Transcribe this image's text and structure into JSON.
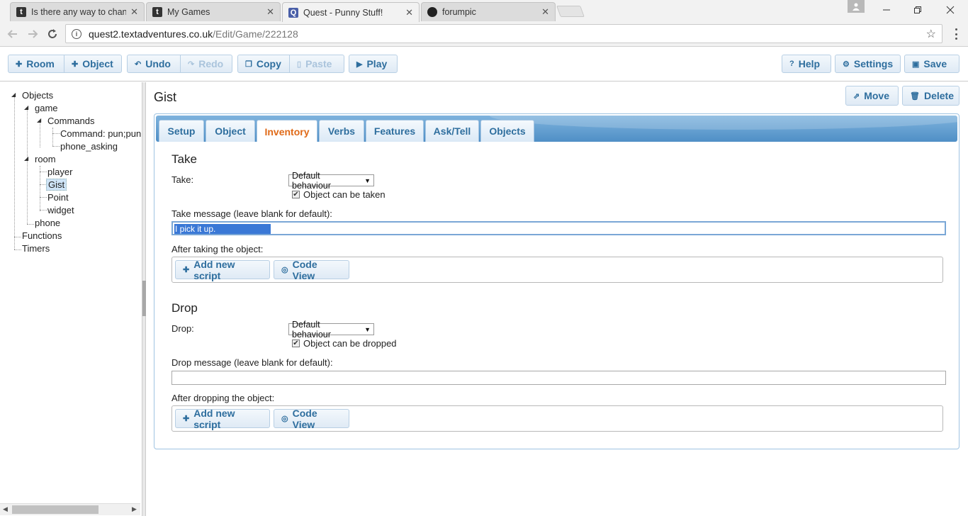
{
  "browser": {
    "tabs": [
      {
        "title": "Is there any way to chang",
        "icon": "t"
      },
      {
        "title": "My Games",
        "icon": "t"
      },
      {
        "title": "Quest - Punny Stuff!",
        "icon": "q"
      },
      {
        "title": "forumpic",
        "icon": "gh"
      }
    ],
    "close_glyph": "✕",
    "url_host": "quest2.textadventures.co.uk",
    "url_path": "/Edit/Game/222128"
  },
  "toolbar": {
    "room": "Room",
    "object": "Object",
    "undo": "Undo",
    "redo": "Redo",
    "copy": "Copy",
    "paste": "Paste",
    "play": "Play",
    "help": "Help",
    "settings": "Settings",
    "save": "Save"
  },
  "tree": {
    "objects": "Objects",
    "game": "game",
    "commands": "Commands",
    "command_pun": "Command: pun;pun",
    "phone_asking": "phone_asking",
    "room": "room",
    "player": "player",
    "gist": "Gist",
    "point": "Point",
    "widget": "widget",
    "phone": "phone",
    "functions": "Functions",
    "timers": "Timers"
  },
  "editor": {
    "title": "Gist",
    "move": "Move",
    "delete": "Delete",
    "tabs": [
      "Setup",
      "Object",
      "Inventory",
      "Verbs",
      "Features",
      "Ask/Tell",
      "Objects"
    ],
    "active_tab": "Inventory",
    "take": {
      "heading": "Take",
      "label": "Take:",
      "select_value": "Default behaviour",
      "checkbox_label": "Object can be taken",
      "checkbox_checked": true,
      "message_label": "Take message (leave blank for default):",
      "message_value": "I pick it up.",
      "after_label": "After taking the object:"
    },
    "drop": {
      "heading": "Drop",
      "label": "Drop:",
      "select_value": "Default behaviour",
      "checkbox_label": "Object can be dropped",
      "checkbox_checked": true,
      "message_label": "Drop message (leave blank for default):",
      "message_value": "",
      "after_label": "After dropping the object:"
    },
    "add_script": "Add new script",
    "code_view": "Code View"
  },
  "colors": {
    "button_text": "#2e6e9e",
    "active_tab_text": "#e06a18",
    "tabs_bar": "#4f8fc6",
    "selection": "#3a78d6"
  }
}
